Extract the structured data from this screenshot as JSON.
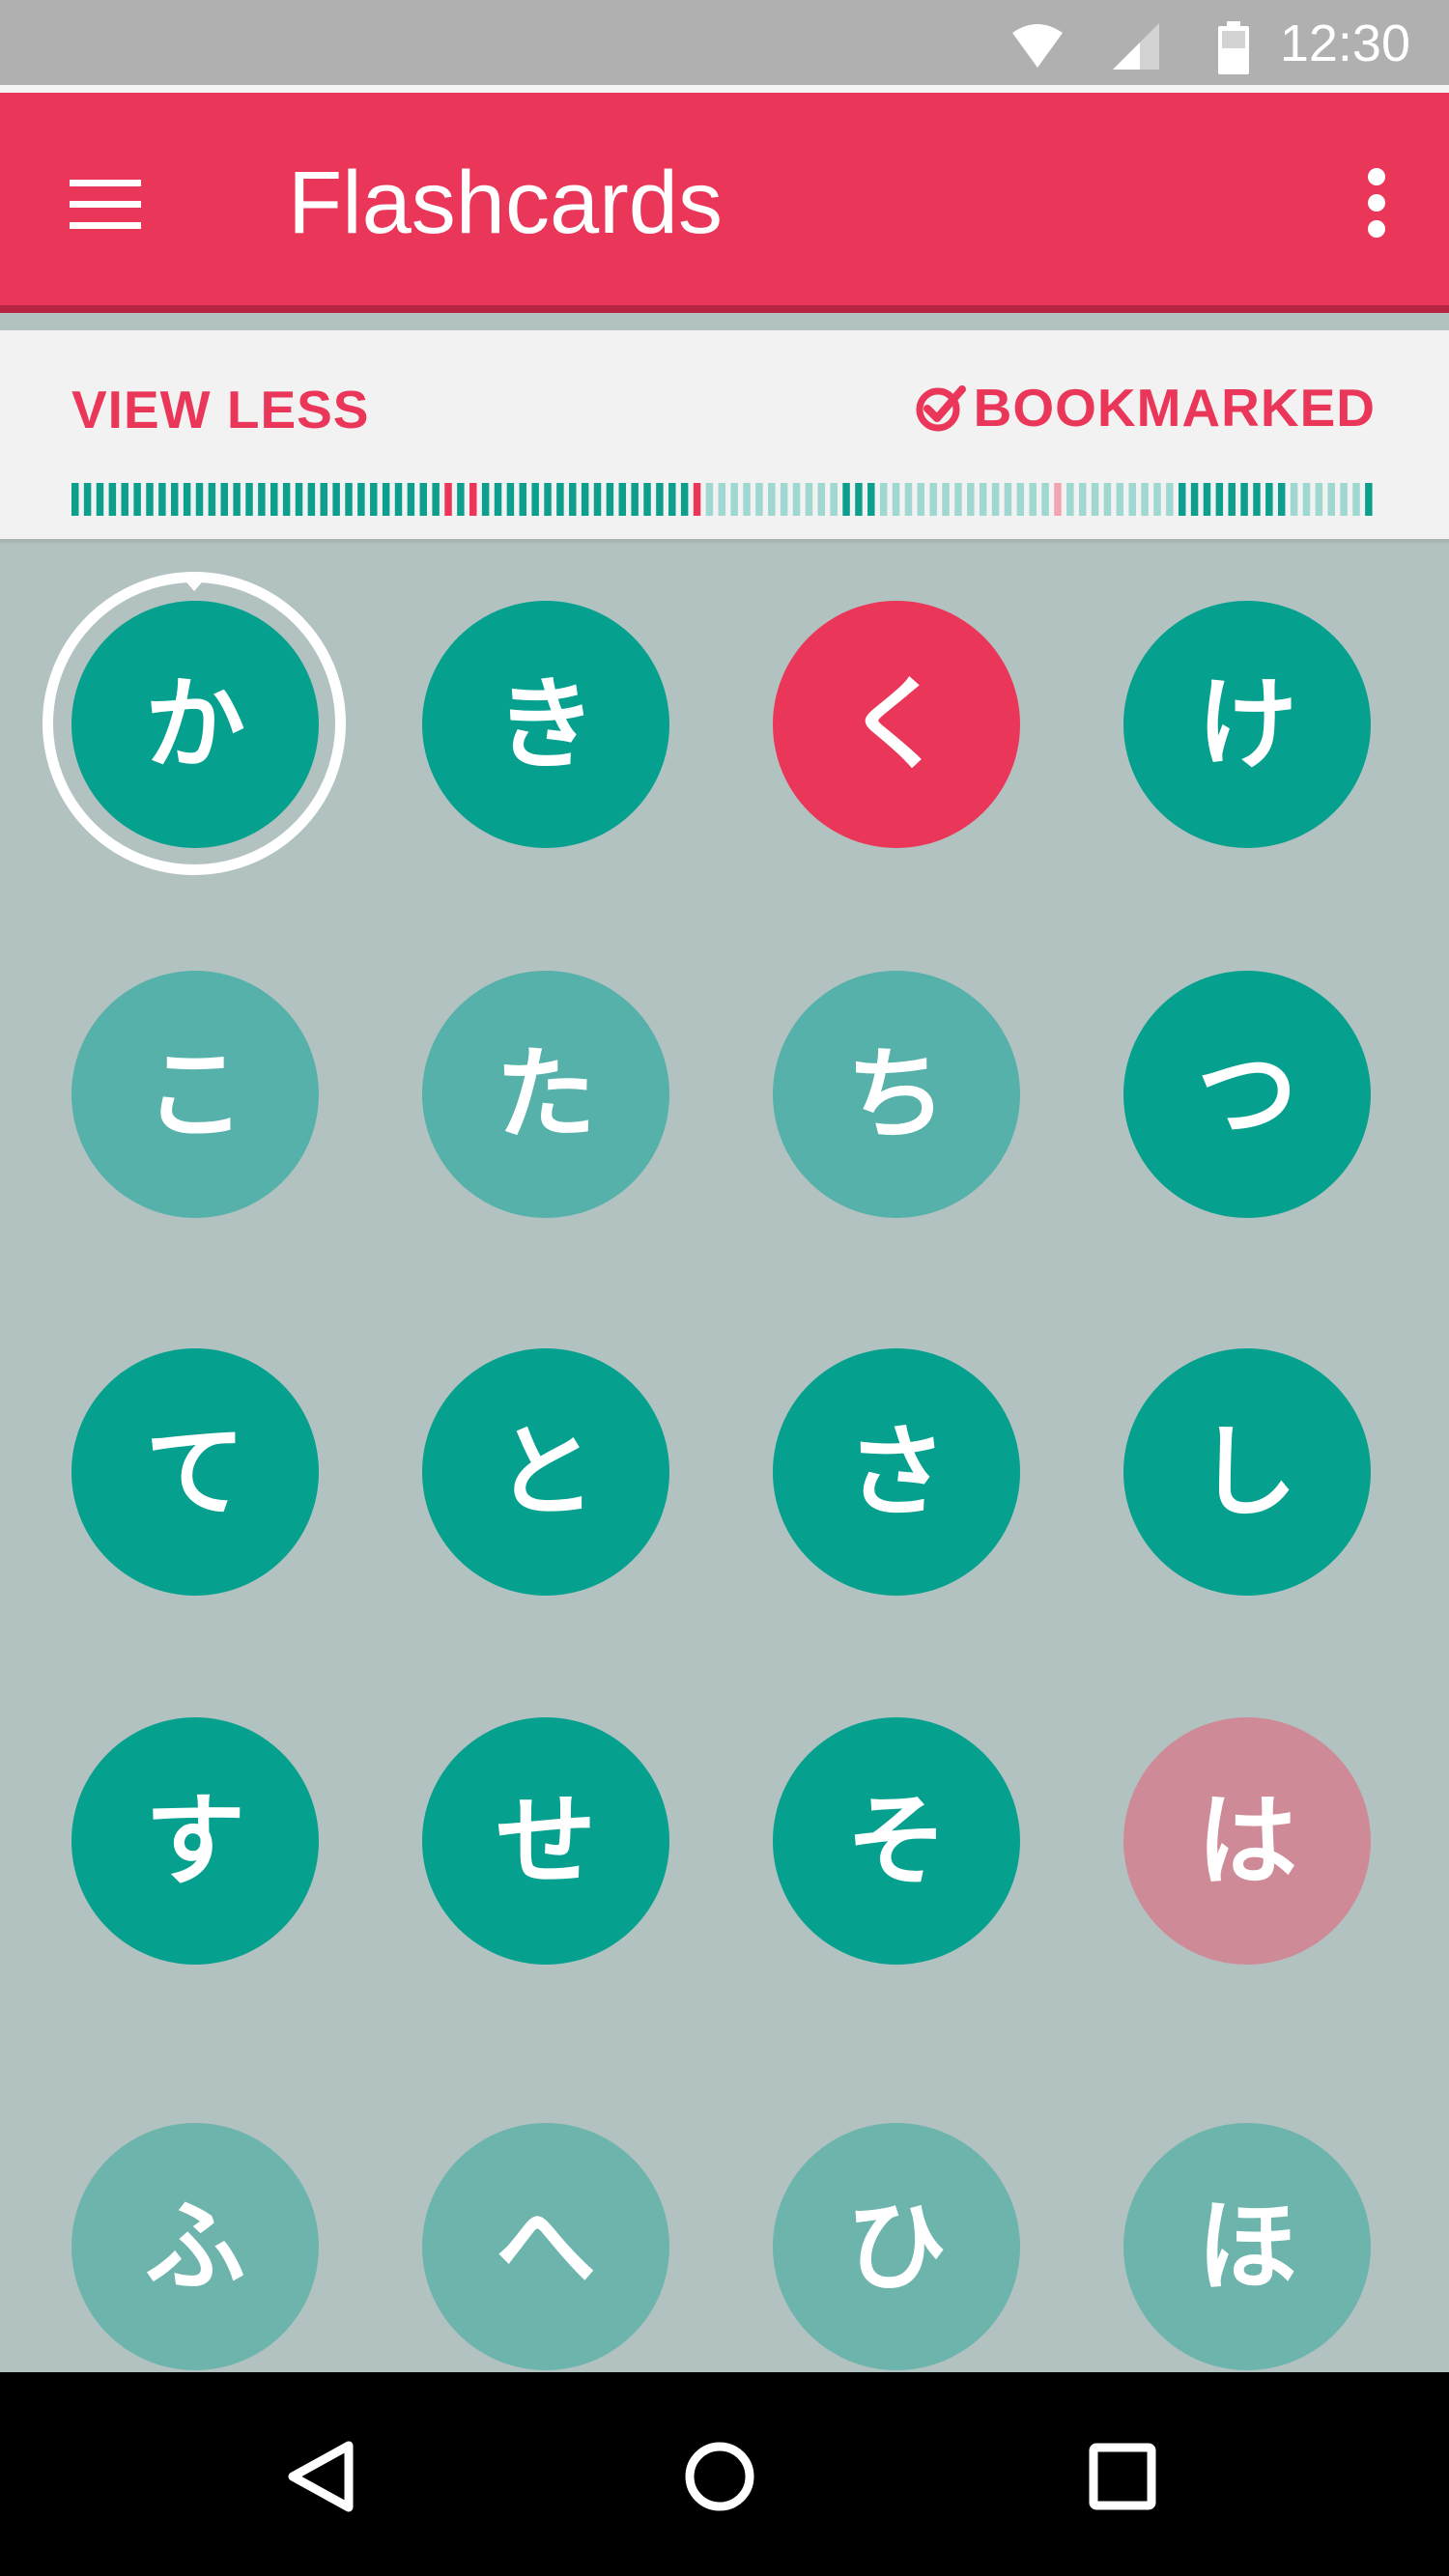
{
  "status_bar": {
    "time": "12:30",
    "icons": [
      "wifi-icon",
      "signal-icon",
      "battery-icon"
    ]
  },
  "app_bar": {
    "title": "Flashcards",
    "menu_icon": "hamburger-menu-icon",
    "more_icon": "more-vert-icon"
  },
  "controls": {
    "view_less_label": "VIEW LESS",
    "bookmarked_label": "BOOKMARKED",
    "bookmarked_icon": "check-circle-icon"
  },
  "progress_ticks": "ddddddddddddddddddddddddddddddrdrdddddddddddddddddrllllllllllldddllllllllllllllpllllllllldddddddddlllllld",
  "colors": {
    "accent": "#ea3659",
    "teal_dark": "#05a08e",
    "teal_medium": "#55b1a9",
    "teal_light": "#6db4ad",
    "pink_muted": "#ce8a97",
    "tick_dark": "#0c9f8d",
    "tick_light": "#9fd7d1",
    "tick_red": "#ea3659",
    "tick_pink": "#f2a4b2"
  },
  "cards": [
    {
      "kana": "か",
      "style": "teal_dark",
      "selected": true
    },
    {
      "kana": "き",
      "style": "teal_dark"
    },
    {
      "kana": "く",
      "style": "accent"
    },
    {
      "kana": "け",
      "style": "teal_dark"
    },
    {
      "kana": "こ",
      "style": "teal_medium"
    },
    {
      "kana": "た",
      "style": "teal_medium"
    },
    {
      "kana": "ち",
      "style": "teal_medium"
    },
    {
      "kana": "つ",
      "style": "teal_dark"
    },
    {
      "kana": "て",
      "style": "teal_dark"
    },
    {
      "kana": "と",
      "style": "teal_dark"
    },
    {
      "kana": "さ",
      "style": "teal_dark"
    },
    {
      "kana": "し",
      "style": "teal_dark"
    },
    {
      "kana": "す",
      "style": "teal_dark"
    },
    {
      "kana": "せ",
      "style": "teal_dark"
    },
    {
      "kana": "そ",
      "style": "teal_dark"
    },
    {
      "kana": "は",
      "style": "pink_muted"
    },
    {
      "kana": "ふ",
      "style": "teal_light"
    },
    {
      "kana": "へ",
      "style": "teal_light"
    },
    {
      "kana": "ひ",
      "style": "teal_light"
    },
    {
      "kana": "ほ",
      "style": "teal_light"
    }
  ],
  "nav_bar": {
    "icons": [
      "back-icon",
      "home-icon",
      "recents-icon"
    ]
  }
}
